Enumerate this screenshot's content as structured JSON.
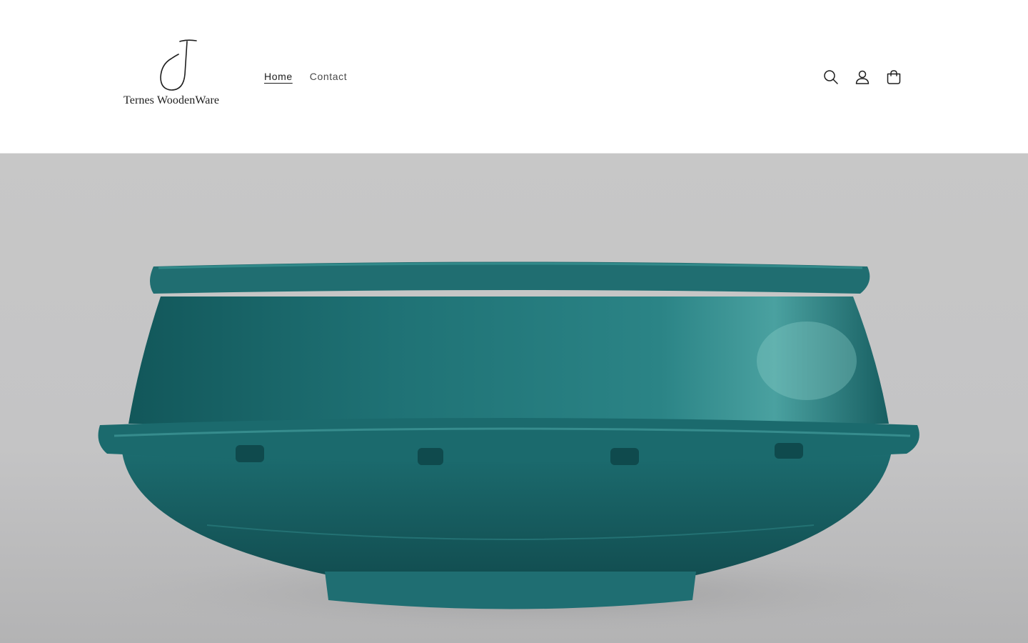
{
  "brand": {
    "name": "Ternes WoodenWare",
    "monogram": "J"
  },
  "nav": {
    "items": [
      {
        "label": "Home",
        "active": true
      },
      {
        "label": "Contact",
        "active": false
      }
    ]
  },
  "header_icons": [
    "search-icon",
    "account-icon",
    "cart-icon"
  ],
  "hero": {
    "subject": "teal wooden bowl",
    "colors": {
      "backdrop": "#c9c9c9",
      "bowl": "#1f6f73",
      "bowl_light": "#3d9a9a"
    }
  }
}
